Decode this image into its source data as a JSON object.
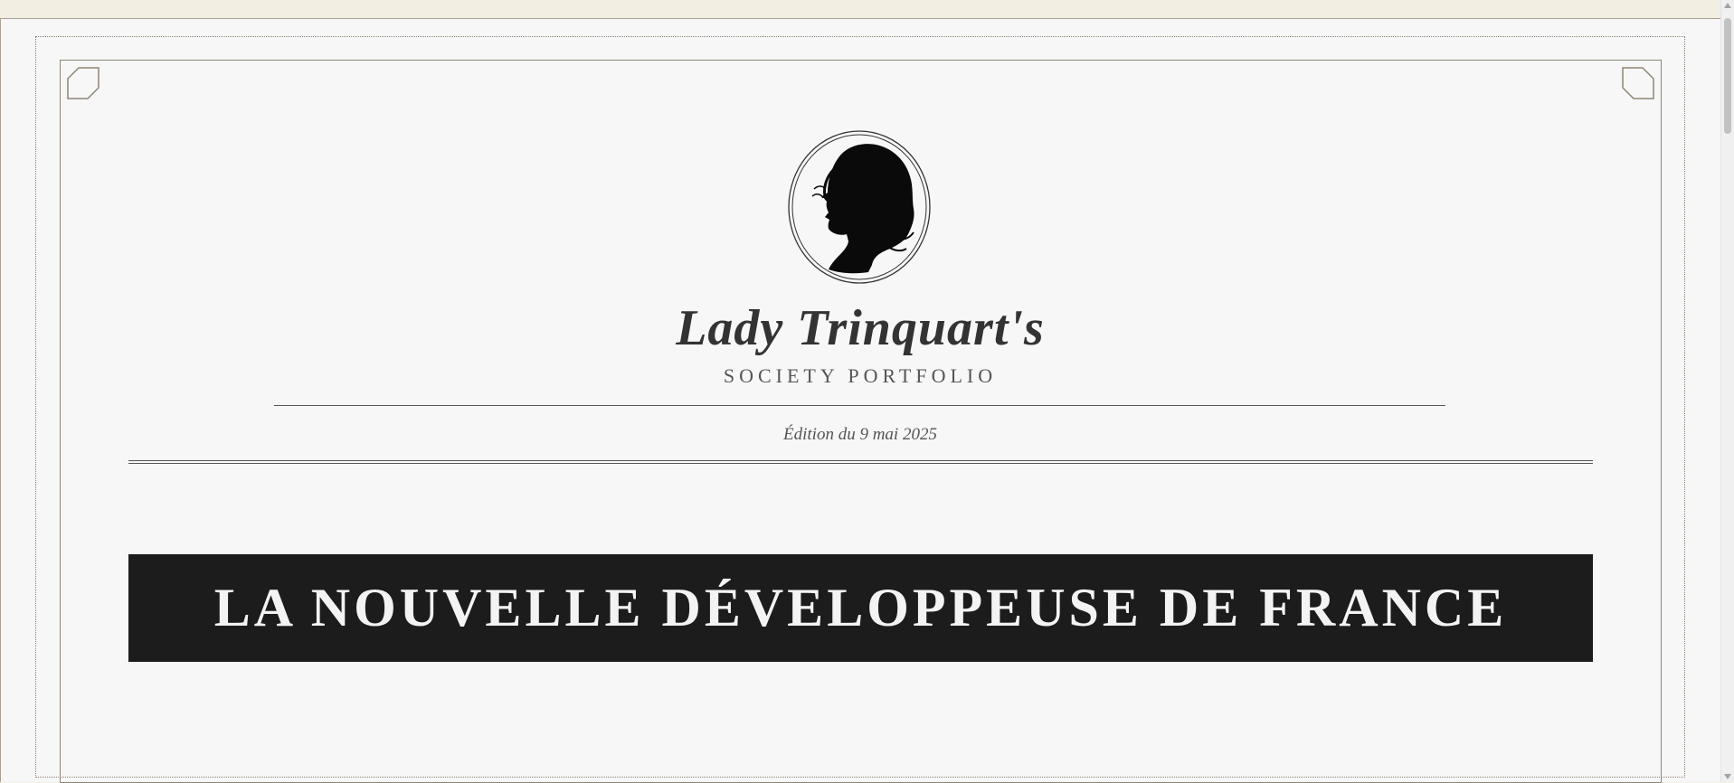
{
  "masthead": {
    "portrait": "woman-silhouette-cameo",
    "title": "Lady Trinquart's",
    "subtitle": "SOCIETY PORTFOLIO",
    "edition": "Édition du 9 mai 2025"
  },
  "banner": {
    "headline": "LA NOUVELLE DÉVELOPPEUSE DE FRANCE"
  },
  "colors": {
    "page_background": "#f7f7f7",
    "banner_background": "#1c1c1c",
    "banner_text": "#f3f3f3",
    "title_text": "#333333"
  }
}
